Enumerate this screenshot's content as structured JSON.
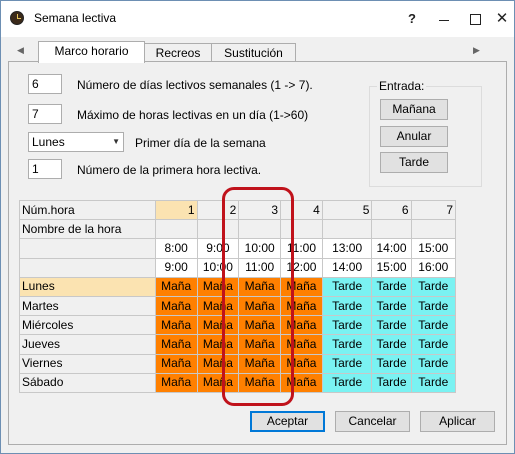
{
  "window": {
    "title": "Semana lectiva"
  },
  "titlebar": {
    "help": "?",
    "close": "✕"
  },
  "tabs": [
    {
      "label": "Marco horario"
    },
    {
      "label": "Recreos"
    },
    {
      "label": "Sustitución"
    }
  ],
  "settings": {
    "days_value": "6",
    "days_label": "Número de días lectivos semanales (1 -> 7).",
    "max_hours_value": "7",
    "max_hours_label": "Máximo de horas lectivas en un día (1->60)",
    "first_day_value": "Lunes",
    "first_day_label": "Primer día de la semana",
    "first_hour_value": "1",
    "first_hour_label": "Número de la primera hora lectiva."
  },
  "entrada": {
    "title": "Entrada:",
    "manana": "Mañana",
    "anular": "Anular",
    "tarde": "Tarde"
  },
  "grid": {
    "num_hora_label": "Núm.hora",
    "nombre_label": "Nombre de la hora",
    "hours": [
      "1",
      "2",
      "3",
      "4",
      "5",
      "6",
      "7"
    ],
    "start_times": [
      "8:00",
      "9:00",
      "10:00",
      "11:00",
      "13:00",
      "14:00",
      "15:00"
    ],
    "end_times": [
      "9:00",
      "10:00",
      "11:00",
      "12:00",
      "14:00",
      "15:00",
      "16:00"
    ],
    "days": [
      "Lunes",
      "Martes",
      "Miércoles",
      "Jueves",
      "Viernes",
      "Sábado"
    ],
    "manana_text": "Maña",
    "tarde_text": "Tarde",
    "manana_color": "#ff8000",
    "tarde_color": "#7af2f2"
  },
  "footer": {
    "aceptar": "Aceptar",
    "cancelar": "Cancelar",
    "aplicar": "Aplicar"
  },
  "annotation": {
    "color": "#c0121b"
  }
}
